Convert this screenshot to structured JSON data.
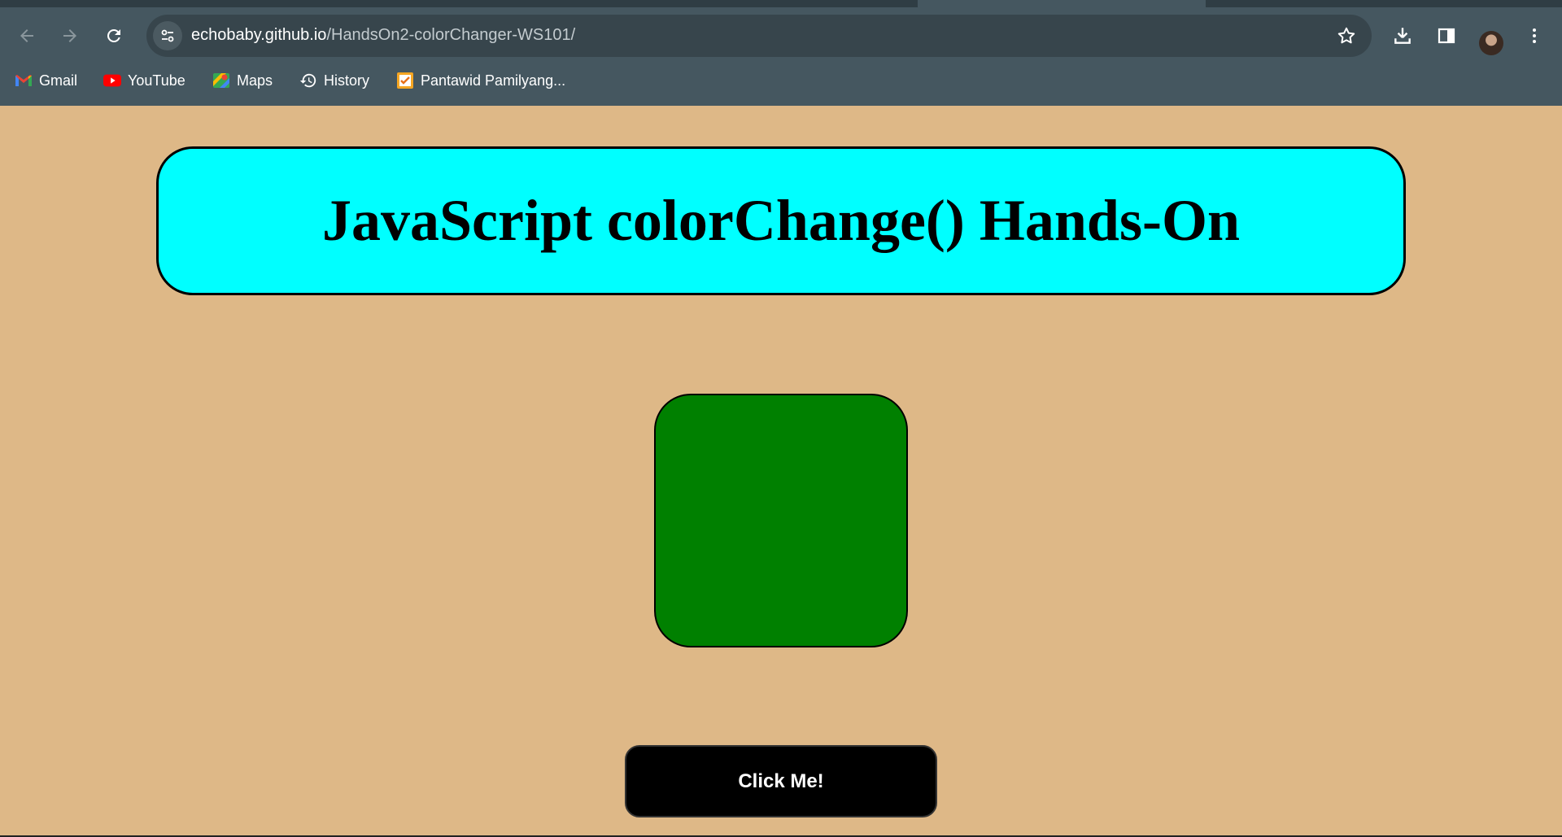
{
  "browser": {
    "url_domain": "echobaby.github.io",
    "url_path": "/HandsOn2-colorChanger-WS101/",
    "bookmarks": [
      {
        "label": "Gmail",
        "icon": "gmail-icon"
      },
      {
        "label": "YouTube",
        "icon": "youtube-icon"
      },
      {
        "label": "Maps",
        "icon": "maps-icon"
      },
      {
        "label": "History",
        "icon": "history-icon"
      },
      {
        "label": "Pantawid Pamilyang...",
        "icon": "pantawid-icon"
      }
    ]
  },
  "page": {
    "heading": "JavaScript colorChange() Hands-On",
    "button_label": "Click Me!",
    "box_color": "#008000",
    "background_color": "#deb887",
    "header_color": "#00ffff"
  }
}
